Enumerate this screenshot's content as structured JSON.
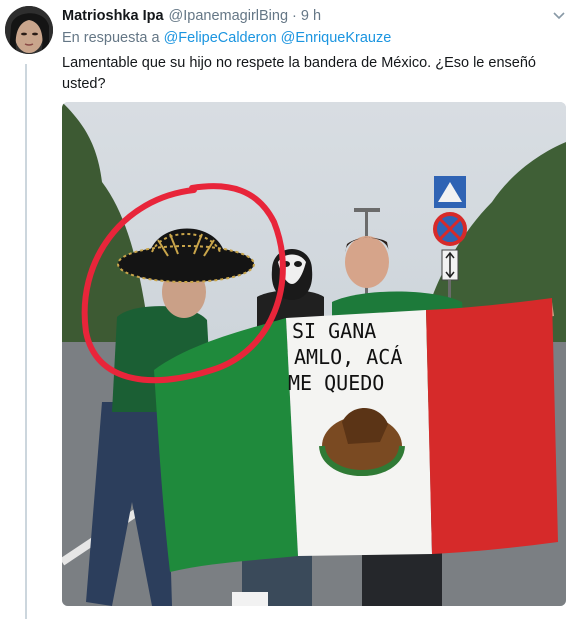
{
  "tweet": {
    "display_name": "Matrioshka Ipa",
    "handle": "@IpanemagirlBing",
    "separator": "·",
    "time": "9 h",
    "reply_prefix": "En respuesta a",
    "reply_mentions": [
      "@FelipeCalderon",
      "@EnriqueKrauze"
    ],
    "text": "Lamentable que su hijo no respete la bandera de México. ¿Eso le enseñó usted?",
    "menu_icon": "chevron-down-icon"
  },
  "photo": {
    "flag_text_lines": [
      "SI GANA",
      "AMLO, ACÁ",
      "ME QUEDO"
    ],
    "colors": {
      "flag_green": "#1f8a3c",
      "flag_white": "#f4f4f2",
      "flag_red": "#d62a2a",
      "circle_red": "#e8253a",
      "link_blue": "#1b95e0"
    }
  }
}
